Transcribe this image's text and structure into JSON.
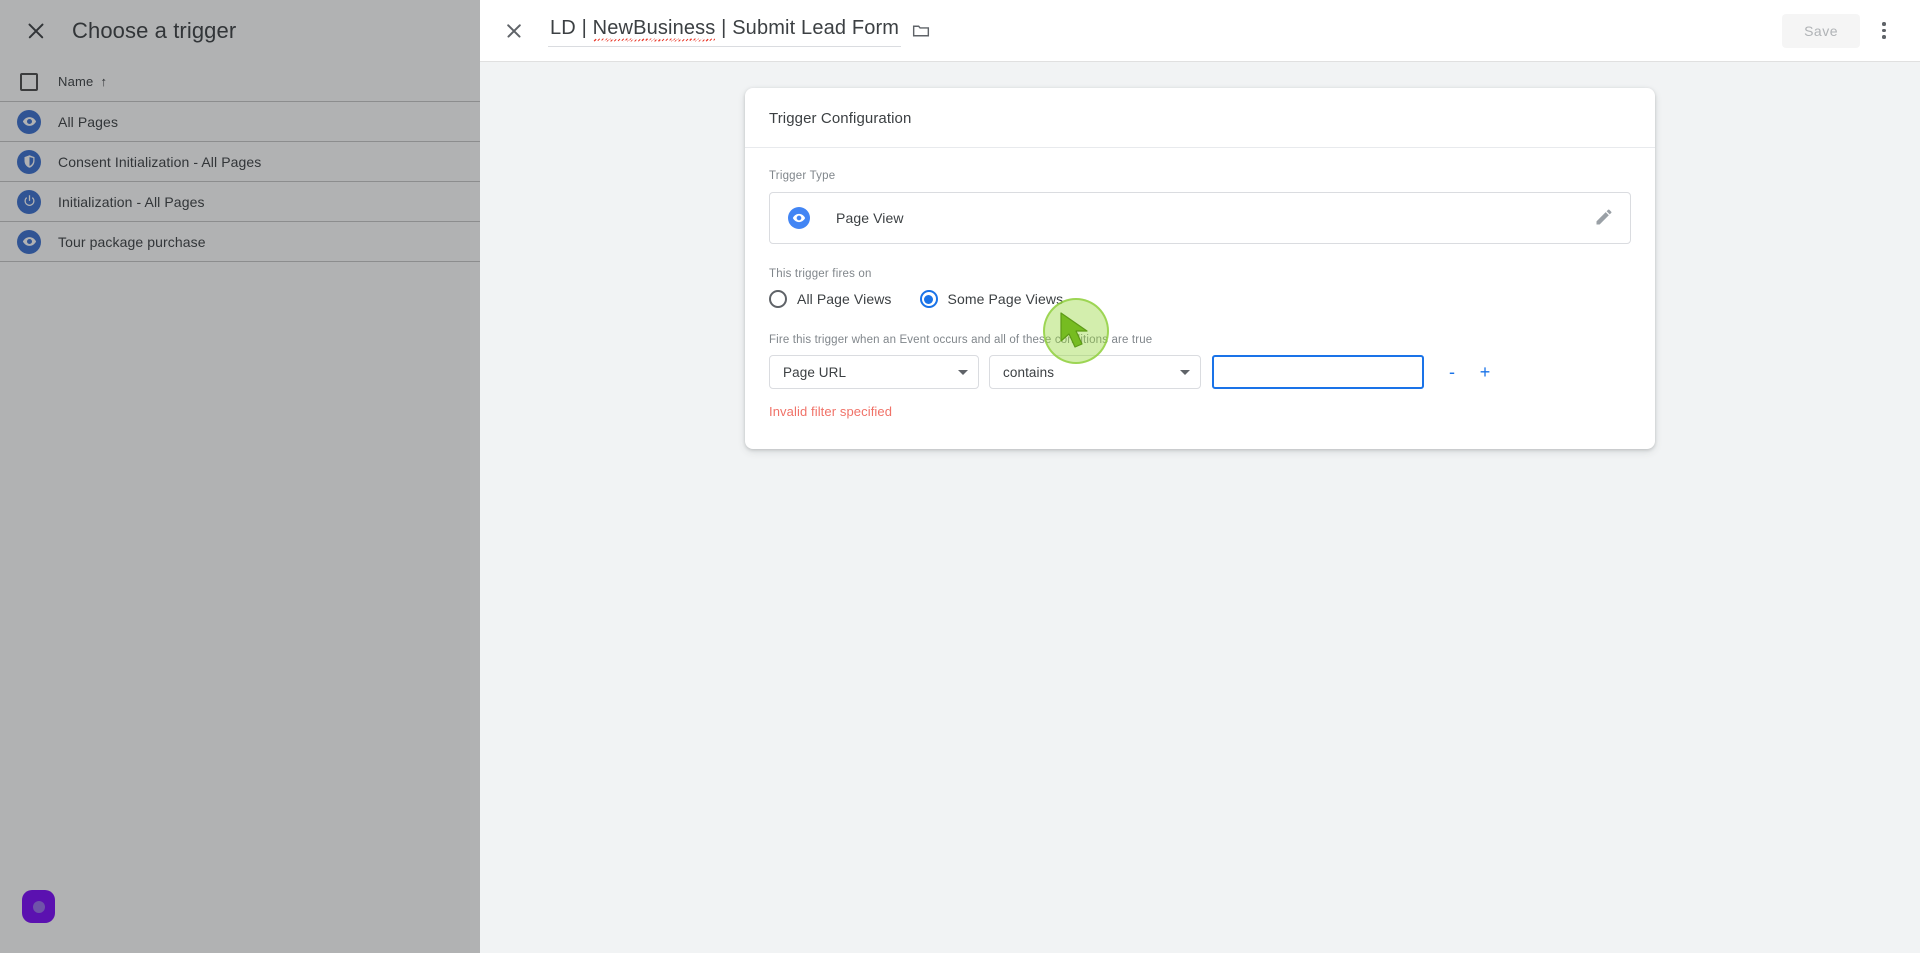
{
  "background_panel": {
    "close_icon": "close-icon",
    "title": "Choose a trigger",
    "table": {
      "select_all_checkbox": "checkbox",
      "column_header": "Name",
      "sort_arrow": "↑",
      "rows": [
        {
          "icon": "eye-icon",
          "name": "All Pages"
        },
        {
          "icon": "shield-icon",
          "name": "Consent Initialization - All Pages"
        },
        {
          "icon": "power-icon",
          "name": "Initialization - All Pages"
        },
        {
          "icon": "eye-icon",
          "name": "Tour package purchase"
        }
      ]
    },
    "fab": {
      "icon": "record-dot-icon",
      "color": "#7c08fb",
      "inner_color": "#9a6ef0"
    }
  },
  "dialog": {
    "close_icon": "close-icon",
    "title": "LD | NewBusiness | Submit Lead Form",
    "title_parts": {
      "before": "LD | ",
      "misspelled": "NewBusiness",
      "after": " | Submit Lead Form"
    },
    "folder_icon": "folder-icon",
    "save_label": "Save",
    "save_disabled": true,
    "overflow_icon": "more-vert-icon"
  },
  "card": {
    "title": "Trigger Configuration",
    "trigger_type_label": "Trigger Type",
    "trigger_type_value": "Page View",
    "trigger_type_icon": "eye-icon",
    "edit_icon": "pencil-icon",
    "fires_on_label": "This trigger fires on",
    "fires_on_options": [
      {
        "label": "All Page Views",
        "selected": false
      },
      {
        "label": "Some Page Views",
        "selected": true
      }
    ],
    "conditions_help": "Fire this trigger when an Event occurs and all of these conditions are true",
    "condition": {
      "variable": "Page URL",
      "operator": "contains",
      "value": "",
      "value_placeholder": "",
      "remove_label": "-",
      "add_label": "+",
      "focused": true
    },
    "error_message": "Invalid filter specified"
  },
  "colors": {
    "accent_blue": "#1a73e8",
    "icon_blue": "#4285f4",
    "error_red": "#f07268",
    "page_bg": "#f1f3f4",
    "cursor_green": "#76bc21"
  },
  "cursor": {
    "icon": "mouse-pointer-icon",
    "highlight": true
  }
}
